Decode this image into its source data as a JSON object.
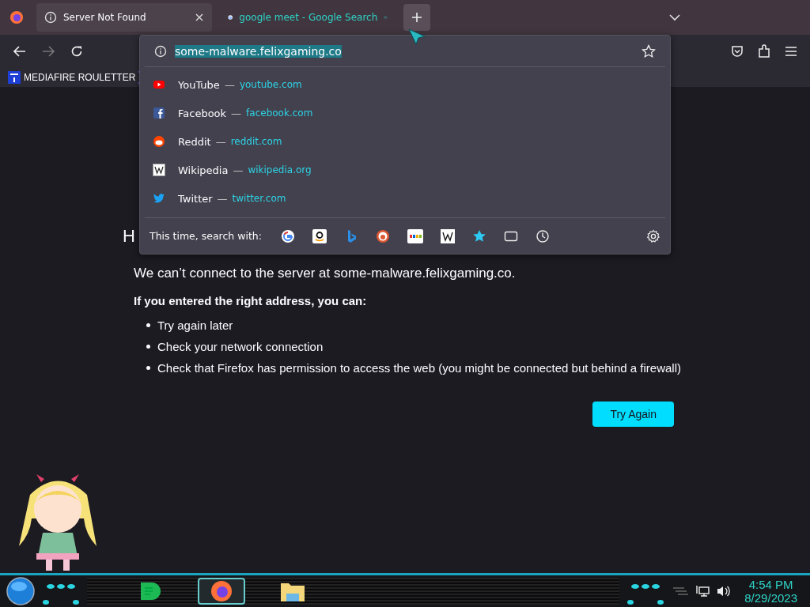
{
  "tabs": [
    {
      "title": "Server Not Found",
      "kind": "error",
      "selected": true
    },
    {
      "title": "google meet - Google Search",
      "kind": "search",
      "selected": false
    }
  ],
  "bookmarks": [
    {
      "label": "MEDIAFIRE ROULETTER"
    }
  ],
  "address_bar": {
    "value": "some-malware.felixgaming.co"
  },
  "suggestions": [
    {
      "kind": "youtube",
      "name": "YouTube",
      "separator": "—",
      "url": "youtube.com"
    },
    {
      "kind": "facebook",
      "name": "Facebook",
      "separator": "—",
      "url": "facebook.com"
    },
    {
      "kind": "reddit",
      "name": "Reddit",
      "separator": "—",
      "url": "reddit.com"
    },
    {
      "kind": "wikipedia",
      "name": "Wikipedia",
      "separator": "—",
      "url": "wikipedia.org"
    },
    {
      "kind": "twitter",
      "name": "Twitter",
      "separator": "—",
      "url": "twitter.com"
    }
  ],
  "search_with": {
    "label": "This time, search with:",
    "engines": [
      {
        "kind": "google"
      },
      {
        "kind": "amazon"
      },
      {
        "kind": "bing"
      },
      {
        "kind": "duckduckgo"
      },
      {
        "kind": "ebay"
      },
      {
        "kind": "wikipedia"
      },
      {
        "kind": "bookmarks"
      },
      {
        "kind": "tabs"
      },
      {
        "kind": "history"
      }
    ]
  },
  "error_page": {
    "title": "H",
    "message": "We can’t connect to the server at some-malware.felixgaming.co.",
    "subtitle": "If you entered the right address, you can:",
    "items": [
      "Try again later",
      "Check your network connection",
      "Check that Firefox has permission to access the web (you might be connected but behind a firewall)"
    ],
    "button": "Try Again"
  },
  "taskbar": {
    "apps": [
      {
        "kind": "notes",
        "active": false
      },
      {
        "kind": "firefox",
        "active": true
      },
      {
        "kind": "folder",
        "active": false
      }
    ],
    "time": "4:54 PM",
    "date": "8/29/2023"
  }
}
